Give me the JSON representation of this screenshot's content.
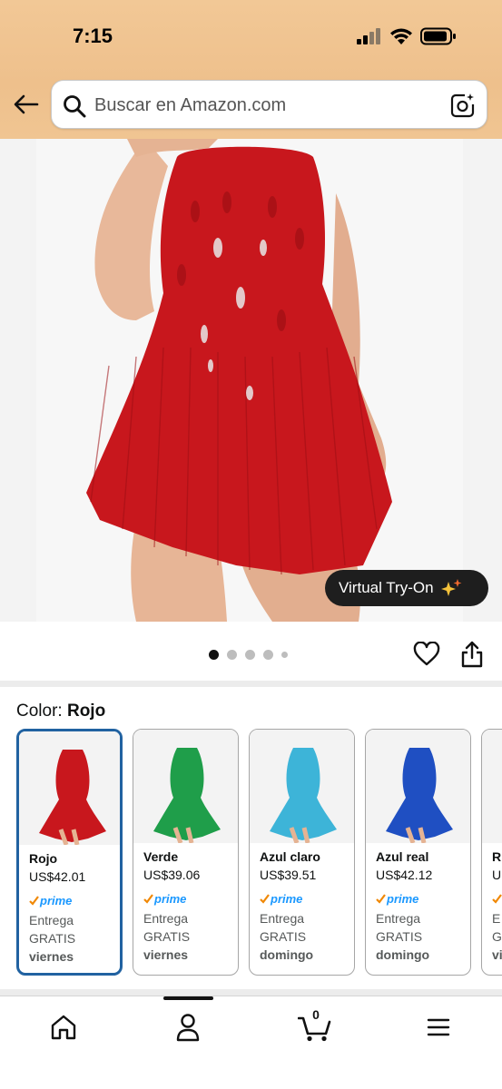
{
  "status_bar": {
    "time": "7:15"
  },
  "search": {
    "placeholder": "Buscar en Amazon.com"
  },
  "product_image": {
    "virtual_try_on_label": "Virtual Try-On",
    "image_count": 5,
    "current_index": 1
  },
  "color_selector": {
    "label": "Color:",
    "selected": "Rojo",
    "options": [
      {
        "name": "Rojo",
        "price": "US$42.01",
        "delivery_line1": "Entrega",
        "delivery_line2": "GRATIS",
        "delivery_day": "viernes",
        "color": "#c8171d"
      },
      {
        "name": "Verde",
        "price": "US$39.06",
        "delivery_line1": "Entrega",
        "delivery_line2": "GRATIS",
        "delivery_day": "viernes",
        "color": "#1f9e4a"
      },
      {
        "name": "Azul claro",
        "price": "US$39.51",
        "delivery_line1": "Entrega",
        "delivery_line2": "GRATIS",
        "delivery_day": "domingo",
        "color": "#3db4d8"
      },
      {
        "name": "Azul real",
        "price": "US$42.12",
        "delivery_line1": "Entrega",
        "delivery_line2": "GRATIS",
        "delivery_day": "domingo",
        "color": "#1f4fc2"
      },
      {
        "name": "R",
        "price": "U",
        "delivery_line1": "E",
        "delivery_line2": "G",
        "delivery_day": "vi",
        "color": "#c8171d"
      }
    ],
    "prime_label": "prime"
  },
  "bottom_nav": {
    "cart_count": "0"
  },
  "colors": {
    "header": "#eec08c",
    "selected_border": "#2162a1",
    "prime_blue": "#1a98ff",
    "prime_check": "#f08804"
  }
}
